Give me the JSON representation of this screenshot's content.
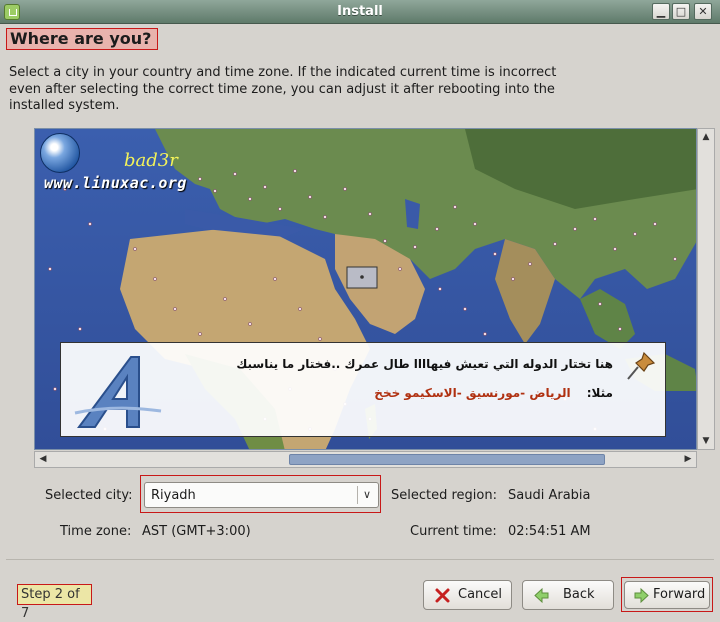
{
  "window": {
    "title": "Install",
    "controls": {
      "minimize": "▁",
      "maximize": "□",
      "close": "✕"
    }
  },
  "page": {
    "heading": "Where are you?",
    "description": "Select a city in your country and time zone. If the indicated current time is incorrect even after selecting the correct time zone, you can adjust it after rebooting into the installed system."
  },
  "watermark": {
    "site": "www.linuxac.org",
    "signature": "bad3r"
  },
  "note": {
    "line1": "هنا تختار الدوله التي تعيش فيهاااا طال عمرك ..فختار ما يناسبك",
    "example_label": "مثلا:",
    "example_values": "الرياض -مورنسيق -الاسكيمو خخخ",
    "icons": [
      "letter-a-logo",
      "pin-icon"
    ]
  },
  "form": {
    "selected_city_label": "Selected city:",
    "selected_city_value": "Riyadh",
    "selected_region_label": "Selected region:",
    "selected_region_value": "Saudi Arabia",
    "time_zone_label": "Time zone:",
    "time_zone_value": "AST (GMT+3:00)",
    "current_time_label": "Current time:",
    "current_time_value": "02:54:51 AM"
  },
  "footer": {
    "step": "Step 2 of 7",
    "cancel_label": "Cancel",
    "back_label": "Back",
    "forward_label": "Forward"
  },
  "colors": {
    "titlebar": "#6f8a7a",
    "highlight_frame": "#c81818",
    "heading_bg": "#e8b3ad",
    "step_bg": "#ece6a6",
    "scroll_thumb": "#8ea3c4"
  }
}
